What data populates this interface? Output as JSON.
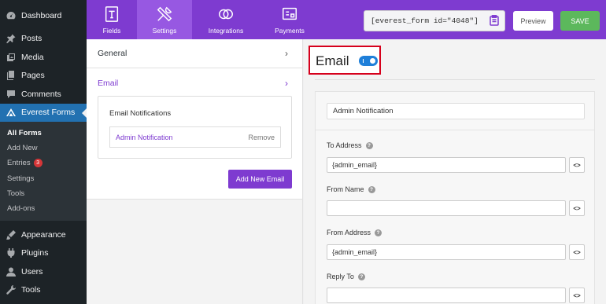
{
  "sidebar": {
    "items_top": [
      {
        "label": "Dashboard",
        "icon": "dashboard-icon"
      },
      {
        "label": "Posts",
        "icon": "pin-icon"
      },
      {
        "label": "Media",
        "icon": "media-icon"
      },
      {
        "label": "Pages",
        "icon": "pages-icon"
      },
      {
        "label": "Comments",
        "icon": "comments-icon"
      },
      {
        "label": "Everest Forms",
        "icon": "everest-forms-icon"
      }
    ],
    "submenu": [
      {
        "label": "All Forms"
      },
      {
        "label": "Add New"
      },
      {
        "label": "Entries",
        "badge": "3"
      },
      {
        "label": "Settings"
      },
      {
        "label": "Tools"
      },
      {
        "label": "Add-ons"
      }
    ],
    "items_bottom": [
      {
        "label": "Appearance",
        "icon": "appearance-icon"
      },
      {
        "label": "Plugins",
        "icon": "plugins-icon"
      },
      {
        "label": "Users",
        "icon": "users-icon"
      },
      {
        "label": "Tools",
        "icon": "tools-icon"
      }
    ]
  },
  "topbar": {
    "tabs": [
      {
        "label": "Fields",
        "icon": "fields-icon"
      },
      {
        "label": "Settings",
        "icon": "settings-icon"
      },
      {
        "label": "Integrations",
        "icon": "integrations-icon"
      },
      {
        "label": "Payments",
        "icon": "payments-icon"
      }
    ],
    "shortcode": "[everest_form id=\"4048\"]",
    "preview_label": "Preview",
    "save_label": "SAVE"
  },
  "settings_panel": {
    "general_label": "General",
    "email_label": "Email",
    "notifications_title": "Email Notifications",
    "notification_name": "Admin Notification",
    "remove_label": "Remove",
    "add_new_email_label": "Add New Email"
  },
  "email_panel": {
    "heading": "Email",
    "enabled": true,
    "notification_name_value": "Admin Notification",
    "fields": [
      {
        "label": "To Address",
        "value": "{admin_email}"
      },
      {
        "label": "From Name",
        "value": ""
      },
      {
        "label": "From Address",
        "value": "{admin_email}"
      },
      {
        "label": "Reply To",
        "value": ""
      }
    ],
    "help_glyph": "?",
    "smart_tag_glyph": "<>"
  },
  "colors": {
    "accent": "#7e3bd0",
    "wp_sidebar": "#1d2327",
    "wp_active": "#2271b1",
    "save_green": "#5cb85c",
    "highlight_red": "#d6001c",
    "toggle_blue": "#1e7fd9"
  }
}
